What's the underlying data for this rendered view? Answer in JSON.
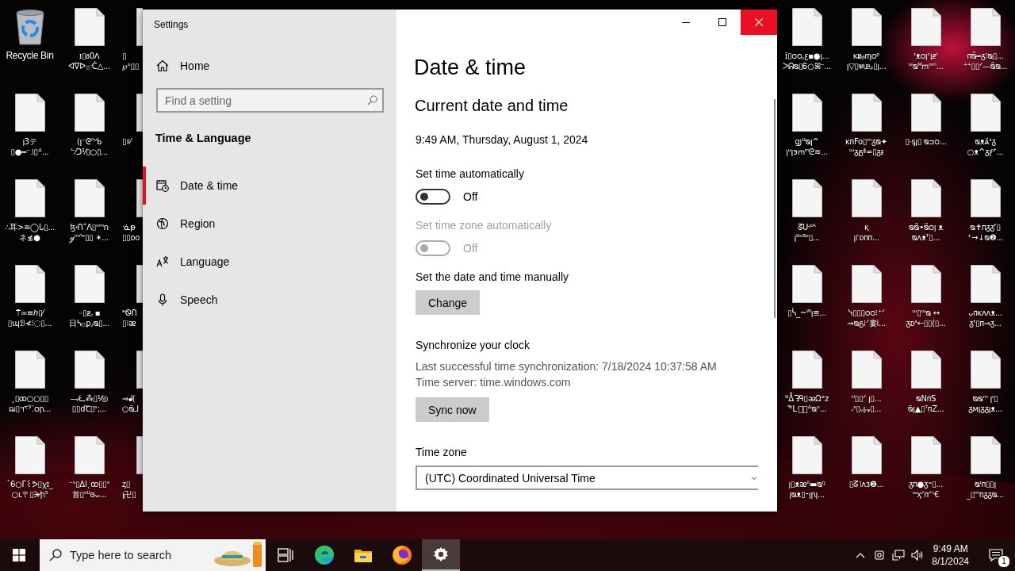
{
  "desktop": {
    "left_columns": [
      [
        {
          "kind": "recycle-bin",
          "label": "Recycle Bin"
        },
        {
          "kind": "file",
          "label": "ꞁ3テ\n▯●━⁻˩▯ᐞ..."
        },
        {
          "kind": "file",
          "label": "∴耳>≋◯ᒐ▯...\nネ≴●"
        },
        {
          "kind": "file",
          "label": "⍑∞≡ℎ▯⁄\n▯ɰℬ≮⁝◌▯..."
        },
        {
          "kind": "file",
          "label": "˛▯ꝏ○○▯▯\nฌ▯ฯ乊⁚ᴑꞃ..."
        },
        {
          "kind": "file",
          "label": "ˋ6○ᒥ꒰ᕗ▯ꭓɪ_\n○ʟ〒▯ᗒ⁄ꞃ⁵"
        }
      ],
      [
        {
          "kind": "file",
          "label": "ɪ▯ᴕ0ꓥ\nᐊᐁᐅ۞ᑣ△..."
        },
        {
          "kind": "file",
          "label": "(ꞁ⁻ᘓᐢᐡᑲ\nᓪ⁄ᑐ⅟▯○▯..."
        },
        {
          "kind": "file",
          "label": "ɮꞏᑎ˄ᐱ▯ᵒᵐn\nℊᵐᐢᐤ▯▯ ✶..."
        },
        {
          "kind": "file",
          "label": "◦▯ᵶ꜀ ▪\n日ᓴ۞ꝑ٫ᴓ▯..."
        },
        {
          "kind": "file",
          "label": "—⁄ᓚ⁂▯⅟◎\n▯▯ɗꞆ▯ᐤ⁏..."
        },
        {
          "kind": "file",
          "label": "⁻ᶟ▯ΔI˛ꝏ▯▯ᐤ\n首▯ᐤᓑɞᴗ..."
        }
      ],
      [
        {
          "kind": "file",
          "label": "▯\n℘ᵒ▯▯"
        },
        {
          "kind": "file",
          "label": "▯♯⁄"
        },
        {
          "kind": "file",
          "label": "ᓍᵽ\n▯▯ᴅᴏ"
        },
        {
          "kind": "file",
          "label": "ᵊᏫᑎ\n▯⁝ᴂ"
        },
        {
          "kind": "file",
          "label": "⇒ᖱ(\n○ᴓ̈ᒧ"
        },
        {
          "kind": "file",
          "label": "ᶎ▯\nꞁ卍▯"
        }
      ]
    ],
    "right_columns": [
      [
        {
          "kind": "file",
          "label": "ɪ̈▯ᴑᴑ꜀ꜫ▪●ꞁ...\nᐳᕱᴓ▯Ꮾ○ꕤ⁻..."
        },
        {
          "kind": "file",
          "label": "ց꠸ᓑᴓꞁ^\nꞁᵘꞁ϶ꭑᵐᘓ≋..."
        },
        {
          "kind": "file",
          "label": "ᘔᑘᵖᴬ\nꞁᓑᵒᔆᶛ▯..."
        },
        {
          "kind": "file",
          "label": "▯ᓵ_~ᵂꞁ≣..."
        },
        {
          "kind": "file",
          "label": "ᓑᐂᘊᑫ▯ꭂᘯᵉᴢ\nᕐᵗᒷ᷊⩍ᐞᴓᵒ..."
        },
        {
          "kind": "file",
          "label": "ꞁ▯ᴥᴂᵟ▬ᴓᵑ\nꞁᴓᴥ▯⁃ꞁꞃꞁ..."
        }
      ],
      [
        {
          "kind": "file",
          "label": "ᴋᴃᵦᶆᴑᵖ\nꞁ▽▯ᴪᵫᵨ▯ꞁ..."
        },
        {
          "kind": "file",
          "label": "ᴋᴨFo▯ᵐᵹᴓ✦\nᵚᵹᵷᶲ=▯ᵹᵻ"
        },
        {
          "kind": "file",
          "label": "ᴋ᷊\nꞁ꜒ᴅᴨᴨ..."
        },
        {
          "kind": "file",
          "label": "ᓭ▯▯▯ᴑᴑ⁝⁺ᐟ\n⇒ᴓᵷ⁞ᐟ婁i..."
        },
        {
          "kind": "file",
          "label": "ᵁ▯▯ᐟ ꞁ▯...\nᵣᵋ▯ᵥꞁᵣᵩ▯..."
        },
        {
          "kind": "file",
          "label": "▯ᘔ˥ᴧᴣ❷..."
        }
      ],
      [
        {
          "kind": "file",
          "label": "ᶦᴥᴑꞁᶜꞁᵶᶤ\nᵎᐡᴓᴹꭑᵒᵐ..."
        },
        {
          "kind": "file",
          "label": "▯·ᶊꞁ▯ ᴓᴝᴑ..."
        },
        {
          "kind": "file",
          "label": "ᴓᴓ̃•ᴓ̃ᴑꞁ ᴥ\nᴓᴧᴥᵀ▯..."
        },
        {
          "kind": "file",
          "label": "ᵚ▯ᵚᴓ ↔\nᵹᴅᵋ←▯▯(▯..."
        },
        {
          "kind": "file",
          "label": "ᴓNᴨS\nᴓ̈ꞁ▲▯ᵀᴨZ..."
        },
        {
          "kind": "file",
          "label": "ᵹᴨ●ᵹ⁼▯...\nᵚᶍᐟᴨᐟᶜ€"
        }
      ],
      [
        {
          "kind": "file",
          "label": "ᴨᴓ̃━ᵹ⁝ᴓ▯...\n⁺⁺▯▯ᐟ—ᴓ̃ᴓ..."
        },
        {
          "kind": "file",
          "label": "ᴓᴥᴀ̈ᵌᵹ\n○ᴥ^ᵹꞁᵖᶠ..."
        },
        {
          "kind": "file",
          "label": "ᴓ✝ᴨᵹᵹᶠ▯\n⁺→↓ᴓ❷..."
        },
        {
          "kind": "file",
          "label": "ᴗᴨᴋᴧᴧᴥ...\nᵹᵗ▯ᴨ⇒ᵹ..."
        },
        {
          "kind": "file",
          "label": "ᴓᴓᵐ ꞁᶦ▯\nᵹᴍꞁᵹᵹꞁᴥ..."
        },
        {
          "kind": "file",
          "label": "ᴓᶦᴨ▯▯ꞁ\n_▯ᵐᴨᵹᵹᴓ..."
        }
      ]
    ]
  },
  "window": {
    "title": "Settings"
  },
  "sidebar": {
    "home": "Home",
    "search": {
      "placeholder": "Find a setting"
    },
    "section": "Time & Language",
    "items": [
      {
        "label": "Date & time",
        "kind": "calendar",
        "selected": true
      },
      {
        "label": "Region",
        "kind": "globe",
        "selected": false
      },
      {
        "label": "Language",
        "kind": "language",
        "selected": false
      },
      {
        "label": "Speech",
        "kind": "microphone",
        "selected": false
      }
    ]
  },
  "content": {
    "title": "Date & time",
    "section": "Current date and time",
    "current": "9:49 AM, Thursday, August 1, 2024",
    "toggles": [
      {
        "label": "Set time automatically",
        "on": false,
        "state_text": "Off",
        "disabled": false
      },
      {
        "label": "Set time zone automatically",
        "on": false,
        "state_text": "Off",
        "disabled": true
      }
    ],
    "manual": {
      "label": "Set the date and time manually",
      "button": "Change"
    },
    "sync": {
      "heading": "Synchronize your clock",
      "last": "Last successful time synchronization: 7/18/2024 10:37:58 AM",
      "server": "Time server: time.windows.com",
      "button": "Sync now"
    },
    "time_zone": {
      "label": "Time zone",
      "value": "(UTC) Coordinated Universal Time"
    }
  },
  "taskbar": {
    "search_placeholder": "Type here to search",
    "apps": [
      {
        "kind": "task-view",
        "selected": false
      },
      {
        "kind": "edge",
        "selected": false
      },
      {
        "kind": "explorer",
        "selected": false
      },
      {
        "kind": "firefox",
        "selected": false
      },
      {
        "kind": "settings",
        "selected": true
      }
    ],
    "clock": {
      "time": "9:49 AM",
      "date": "8/1/2024"
    },
    "notification_count": "1"
  }
}
